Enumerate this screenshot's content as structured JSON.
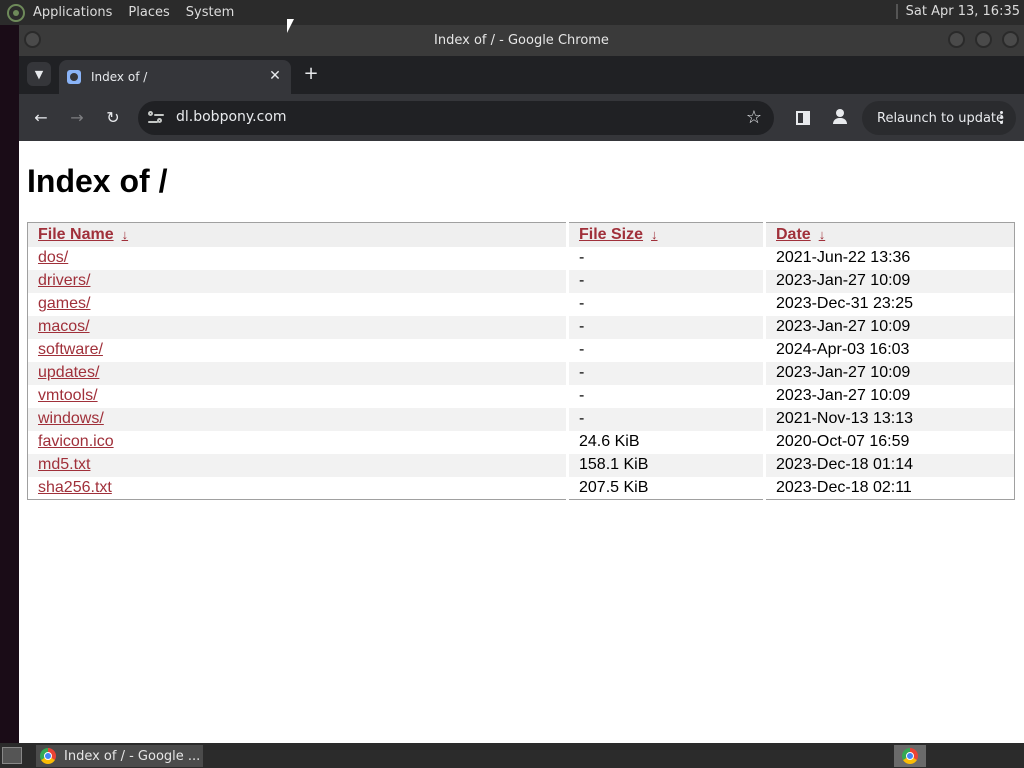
{
  "top_panel": {
    "menus": [
      "Applications",
      "Places",
      "System"
    ],
    "clock": "Sat Apr 13, 16:35"
  },
  "window": {
    "title": "Index of / - Google Chrome"
  },
  "tabs": [
    {
      "label": "Index of /"
    }
  ],
  "toolbar": {
    "url": "dl.bobpony.com",
    "relaunch_label": "Relaunch to update"
  },
  "page": {
    "heading": "Index of /",
    "columns": [
      "File Name",
      "File Size",
      "Date"
    ],
    "sort_arrow": "↓",
    "rows": [
      {
        "name": "dos/",
        "size": "-",
        "date": "2021-Jun-22 13:36"
      },
      {
        "name": "drivers/",
        "size": "-",
        "date": "2023-Jan-27 10:09"
      },
      {
        "name": "games/",
        "size": "-",
        "date": "2023-Dec-31 23:25"
      },
      {
        "name": "macos/",
        "size": "-",
        "date": "2023-Jan-27 10:09"
      },
      {
        "name": "software/",
        "size": "-",
        "date": "2024-Apr-03 16:03"
      },
      {
        "name": "updates/",
        "size": "-",
        "date": "2023-Jan-27 10:09"
      },
      {
        "name": "vmtools/",
        "size": "-",
        "date": "2023-Jan-27 10:09"
      },
      {
        "name": "windows/",
        "size": "-",
        "date": "2021-Nov-13 13:13"
      },
      {
        "name": "favicon.ico",
        "size": "24.6 KiB",
        "date": "2020-Oct-07 16:59"
      },
      {
        "name": "md5.txt",
        "size": "158.1 KiB",
        "date": "2023-Dec-18 01:14"
      },
      {
        "name": "sha256.txt",
        "size": "207.5 KiB",
        "date": "2023-Dec-18 02:11"
      }
    ]
  },
  "taskbar": {
    "items": [
      {
        "label": "Index of / - Google ..."
      }
    ]
  },
  "colors": {
    "link": "#a0303a",
    "chrome_dark": "#202124",
    "chrome_toolbar": "#35363a"
  }
}
